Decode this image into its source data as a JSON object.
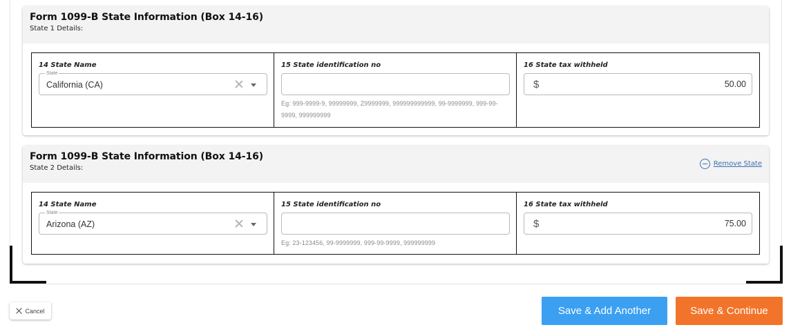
{
  "states": [
    {
      "title": "Form 1099-B State Information (Box 14-16)",
      "subtitle": "State 1 Details:",
      "remove_label": "",
      "state_name_label": "14 State Name",
      "state_float_label": "State",
      "state_value": "California (CA)",
      "state_id_label": "15 State identification no",
      "state_id_value": "",
      "state_id_hint": "Eg: 999-9999-9, 99999999, Z9999999, 999999999999, 99-9999999, 999-99-9999, 999999999",
      "tax_label": "16 State tax withheld",
      "currency_symbol": "$",
      "tax_value": "50.00"
    },
    {
      "title": "Form 1099-B State Information (Box 14-16)",
      "subtitle": "State 2 Details:",
      "remove_label": "Remove State",
      "state_name_label": "14 State Name",
      "state_float_label": "State",
      "state_value": "Arizona (AZ)",
      "state_id_label": "15 State identification no",
      "state_id_value": "",
      "state_id_hint": "Eg: 23-123456, 99-9999999, 999-99-9999, 999999999",
      "tax_label": "16 State tax withheld",
      "currency_symbol": "$",
      "tax_value": "75.00"
    }
  ],
  "footer": {
    "cancel_label": "Cancel",
    "save_add_label": "Save & Add Another",
    "save_continue_label": "Save & Continue"
  },
  "icons": {
    "clear": "close-icon",
    "dropdown": "chevron-down-icon",
    "remove": "minus-circle-icon",
    "cancel": "close-icon"
  },
  "colors": {
    "save_add": "#3ba0f2",
    "save_continue": "#f2742a",
    "link": "#3a6fb0"
  }
}
